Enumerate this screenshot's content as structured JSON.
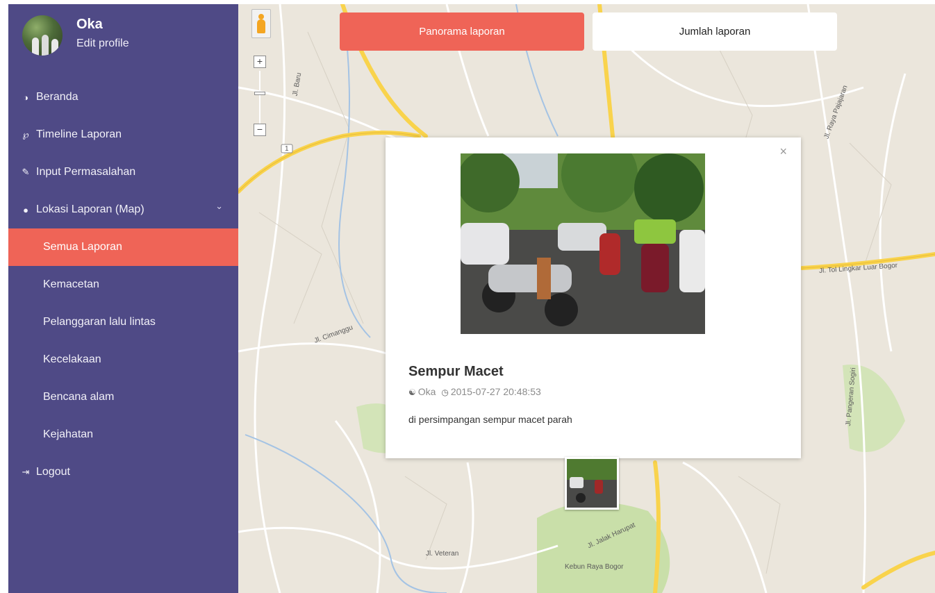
{
  "profile": {
    "name": "Oka",
    "edit_label": "Edit profile"
  },
  "menu": {
    "beranda": "Beranda",
    "timeline": "Timeline Laporan",
    "input": "Input Permasalahan",
    "lokasi": "Lokasi Laporan (Map)",
    "logout": "Logout",
    "sub": {
      "semua": "Semua Laporan",
      "kemacetan": "Kemacetan",
      "pelanggaran": "Pelanggaran lalu lintas",
      "kecelakaan": "Kecelakaan",
      "bencana": "Bencana alam",
      "kejahatan": "Kejahatan"
    }
  },
  "tabs": {
    "panorama": "Panorama laporan",
    "jumlah": "Jumlah laporan"
  },
  "popup": {
    "title": "Sempur Macet",
    "author": "Oka",
    "datetime": "2015-07-27 20:48:53",
    "description": "di persimpangan sempur macet parah",
    "close_symbol": "×"
  },
  "map_labels": {
    "jl_baru": "Jl. Baru",
    "jl_cimanggu": "Jl. Cimanggu",
    "jl_lingkar": "Jl. Tol Lingkar Luar Bogor",
    "jl_pajajaran": "Jl. Raya Pajajaran",
    "jl_pangeran": "Jl. Pangeran Sogiri",
    "jl_perjuangan": "Jl. Veteran",
    "kebun_raya": "Kebun Raya Bogor",
    "jalak_harupat": "Jl. Jalak Harupat",
    "road_1": "1"
  },
  "colors": {
    "sidebar": "#4f4a86",
    "accent": "#ef6457",
    "map_bg": "#ebe6dc",
    "road_major": "#f9d34c"
  }
}
